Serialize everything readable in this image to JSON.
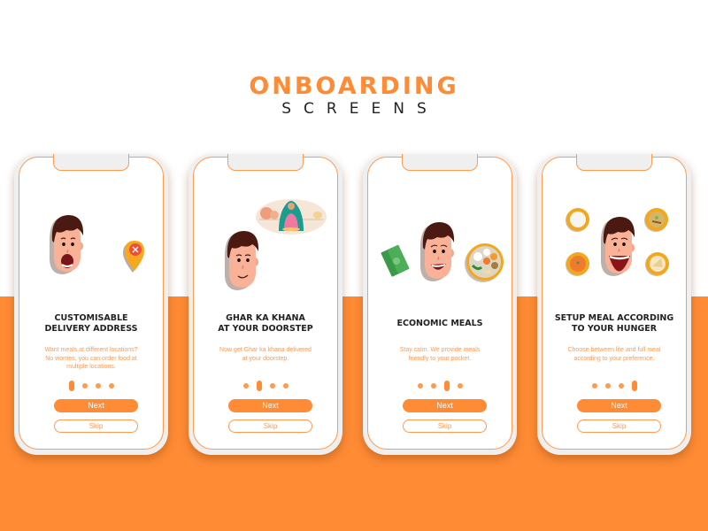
{
  "header": {
    "title": "ONBOARDING",
    "subtitle": "SCREENS"
  },
  "colors": {
    "accent": "#FF8B35",
    "text_dark": "#222222",
    "description": "#FF9A52",
    "frame": "#EFEFEF"
  },
  "screens": [
    {
      "illustration": [
        "shocked-face-icon",
        "location-pin-cross-icon"
      ],
      "heading_line1": "CUSTOMISABLE",
      "heading_line2": "DELIVERY ADDRESS",
      "desc_line1": "Want meals at different locations?",
      "desc_line2": "No worries, you can order food at",
      "desc_line3": "multiple locations.",
      "active_page": 1,
      "total_pages": 4,
      "next_label": "Next",
      "skip_label": "Skip"
    },
    {
      "illustration": [
        "smiling-face-icon",
        "thought-bubble-cooking-woman-icon"
      ],
      "heading_line1": "GHAR KA KHANA",
      "heading_line2": "AT YOUR DOORSTEP",
      "desc_line1": "Now get Ghar ka khana delivered",
      "desc_line2": "at your doorstep.",
      "desc_line3": "",
      "active_page": 2,
      "total_pages": 4,
      "next_label": "Next",
      "skip_label": "Skip"
    },
    {
      "illustration": [
        "money-notes-icon",
        "happy-face-icon",
        "thali-plate-icon"
      ],
      "heading_line1": "ECONOMIC MEALS",
      "heading_line2": "",
      "desc_line1": "Stay calm. We provide meals",
      "desc_line2": "friendly to your pocket.",
      "desc_line3": "",
      "active_page": 3,
      "total_pages": 4,
      "next_label": "Next",
      "skip_label": "Skip"
    },
    {
      "illustration": [
        "laughing-face-icon",
        "rice-bowl-icon",
        "curry-bowl-icon",
        "orange-dish-icon",
        "snack-plate-icon"
      ],
      "heading_line1": "SETUP MEAL ACCORDING",
      "heading_line2": "TO YOUR HUNGER",
      "desc_line1": "Choose between lite and full meal",
      "desc_line2": "according to your preference.",
      "desc_line3": "",
      "active_page": 4,
      "total_pages": 4,
      "next_label": "Next",
      "skip_label": "Skip"
    }
  ]
}
